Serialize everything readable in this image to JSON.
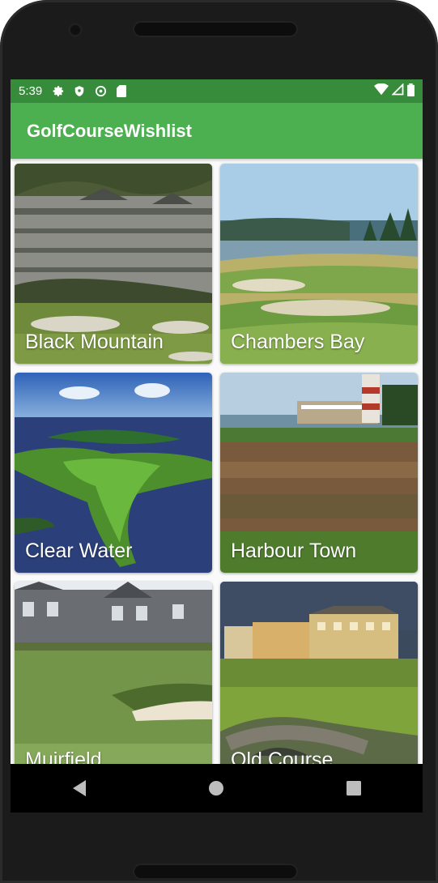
{
  "status_bar": {
    "time": "5:39",
    "left_icons": [
      "gear-icon",
      "shield-icon",
      "at-sign-icon",
      "sd-card-icon"
    ],
    "right_icons": [
      "wifi-icon",
      "cell-signal-icon",
      "battery-icon"
    ]
  },
  "app_bar": {
    "title": "GolfCourseWishlist",
    "color": "#4caf50"
  },
  "courses": [
    {
      "name": "Black Mountain"
    },
    {
      "name": "Chambers Bay"
    },
    {
      "name": "Clear Water"
    },
    {
      "name": "Harbour Town"
    },
    {
      "name": "Muirfield"
    },
    {
      "name": "Old Course"
    }
  ],
  "nav_bar": {
    "buttons": [
      "back-button",
      "home-button",
      "recents-button"
    ]
  }
}
